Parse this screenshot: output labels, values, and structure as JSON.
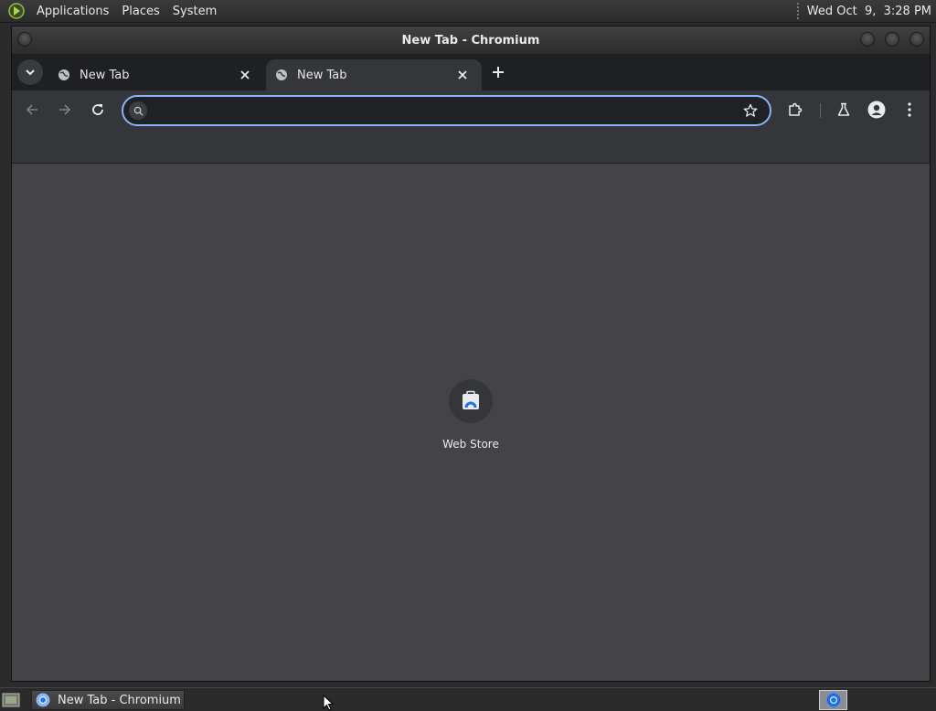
{
  "top_panel": {
    "menus": [
      "Applications",
      "Places",
      "System"
    ],
    "clock": "Wed Oct  9,  3:28 PM"
  },
  "window": {
    "title": "New Tab - Chromium"
  },
  "tabs": [
    {
      "label": "New Tab",
      "active": false
    },
    {
      "label": "New Tab",
      "active": true
    }
  ],
  "omnibox": {
    "value": "",
    "placeholder": ""
  },
  "shortcuts": [
    {
      "label": "Web Store"
    }
  ],
  "taskbar": {
    "task_label": "New Tab - Chromium"
  },
  "colors": {
    "accent": "#8ab4f8",
    "content_bg": "#434348",
    "toolbar_bg": "#35363a"
  }
}
